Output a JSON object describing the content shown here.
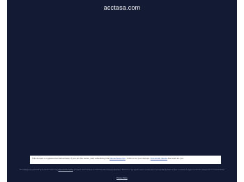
{
  "site": {
    "title": "acctasa.com"
  },
  "notice": {
    "text_1": "This domain is registered at Namecheap. If you are the owner, start advertising it at ",
    "link_1": "Namecheap.com",
    "text_2": ". If this is not your domain, ",
    "link_2": "find similar names",
    "text_3": " that work for you."
  },
  "disclaimer": {
    "text_1": "This webpage was generated by the domain owner using ",
    "link": "Sedo Domain Parking",
    "text_2": ". Disclaimer: Sedo maintains no relationship with third party advertisers. Reference to any specific service or trade mark is not controlled by Sedo nor does it constitute or imply its association, endorsement or recommendation."
  },
  "footer": {
    "privacy_label": "Privacy Policy"
  }
}
